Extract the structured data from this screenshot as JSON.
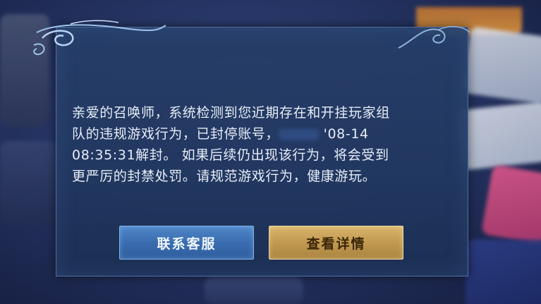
{
  "dialog": {
    "message_line_1": "亲爱的召唤师，系统检测到您近期存在和开挂玩家组",
    "message_line_2a": "队的违规游戏行为，已封停账号，",
    "message_line_2b": "08-14",
    "message_line_3": "08:35:31解封。 如果后续仍出现该行为，将会受到",
    "message_line_4": "更严厉的封禁处罚。请规范游戏行为，健康游玩。"
  },
  "buttons": {
    "contact_label": "联系客服",
    "details_label": "查看详情"
  },
  "colors": {
    "contact_button": "#3a6db0",
    "details_button": "#c29a52",
    "dialog_background": "#263e68",
    "message_text": "#e7edf8"
  }
}
